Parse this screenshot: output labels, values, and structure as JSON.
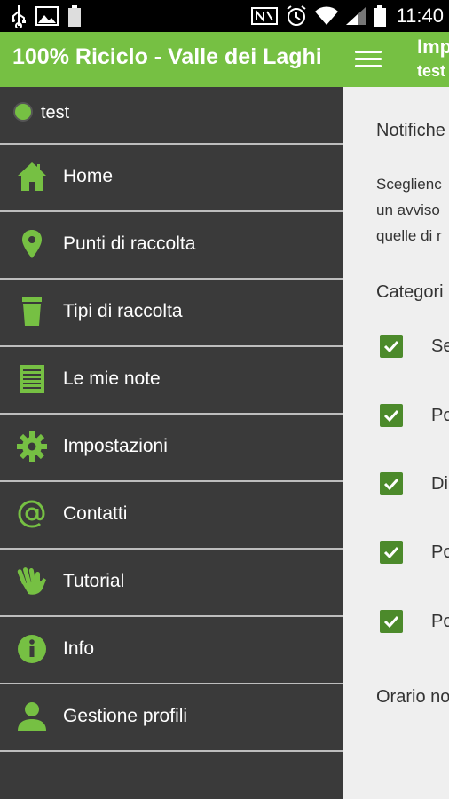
{
  "status_bar": {
    "time": "11:40"
  },
  "drawer": {
    "title": "100% Riciclo - Valle dei Laghi",
    "profile": {
      "name": "test"
    },
    "items": [
      {
        "label": "Home",
        "icon": "home-icon"
      },
      {
        "label": "Punti di raccolta",
        "icon": "location-pin-icon"
      },
      {
        "label": "Tipi di raccolta",
        "icon": "bin-icon"
      },
      {
        "label": "Le mie note",
        "icon": "notes-icon"
      },
      {
        "label": "Impostazioni",
        "icon": "gear-icon"
      },
      {
        "label": "Contatti",
        "icon": "at-icon"
      },
      {
        "label": "Tutorial",
        "icon": "hand-icon"
      },
      {
        "label": "Info",
        "icon": "info-icon"
      },
      {
        "label": "Gestione profili",
        "icon": "person-icon"
      }
    ]
  },
  "content": {
    "title": "Imp",
    "subtitle": "test",
    "section_title": "Notifiche",
    "description": [
      "Sceglienc",
      "un avviso",
      "quelle di r"
    ],
    "categories_title": "Categori",
    "checkboxes": [
      {
        "label": "Se",
        "checked": true
      },
      {
        "label": "Po",
        "checked": true
      },
      {
        "label": "Di",
        "checked": true
      },
      {
        "label": "Po",
        "checked": true
      },
      {
        "label": "Po",
        "checked": true
      }
    ],
    "time_title": "Orario no"
  },
  "colors": {
    "accent": "#76c043",
    "drawer_bg": "#3a3a3a",
    "checkbox": "#4c8a2b"
  }
}
